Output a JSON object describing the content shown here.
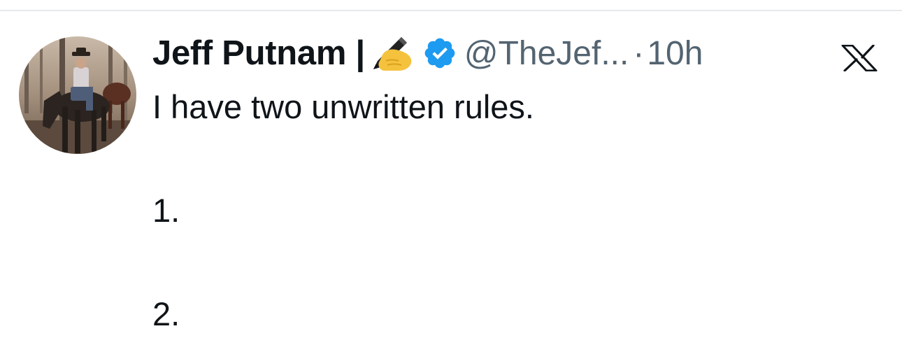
{
  "tweet": {
    "display_name": "Jeff Putnam |",
    "name_emoji": "writing-hand-emoji",
    "verified": true,
    "handle": "@TheJef...",
    "separator": "·",
    "timestamp": "10h",
    "body_lines": [
      "I have two unwritten rules.",
      "",
      "1.",
      "",
      "2."
    ]
  },
  "icons": {
    "avatar": "profile-photo-rider-on-horse",
    "verified": "verified-badge-icon",
    "brand": "x-logo-icon"
  },
  "colors": {
    "text_primary": "#0f1419",
    "text_secondary": "#536471",
    "verified_blue": "#1d9bf0",
    "divider": "#e6e9eb"
  }
}
